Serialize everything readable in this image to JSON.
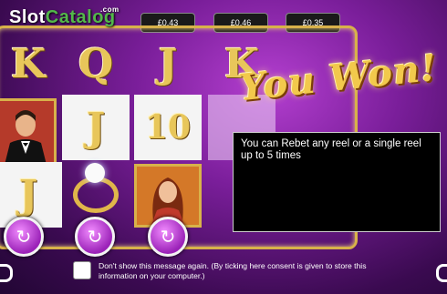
{
  "logo": {
    "slot": "Slot",
    "catalog": "Catalog",
    "com": ".com"
  },
  "bets": [
    "£0.43",
    "£0.46",
    "£0.35"
  ],
  "reels": {
    "row1": [
      "K",
      "Q",
      "J",
      "K"
    ],
    "row2": [
      "J",
      "10"
    ],
    "row3": [
      "J"
    ]
  },
  "headline": "You Won!",
  "dialog": {
    "message": "You can Rebet any reel or a single reel up to 5 times"
  },
  "rebet_icon": "↻",
  "consent": {
    "text": "Don't show this message again. (By ticking here consent is given to store this information on your computer.)"
  },
  "colors": {
    "accent": "#d8b24a",
    "background": "#7a1e9a",
    "button": "#b23ad0"
  }
}
